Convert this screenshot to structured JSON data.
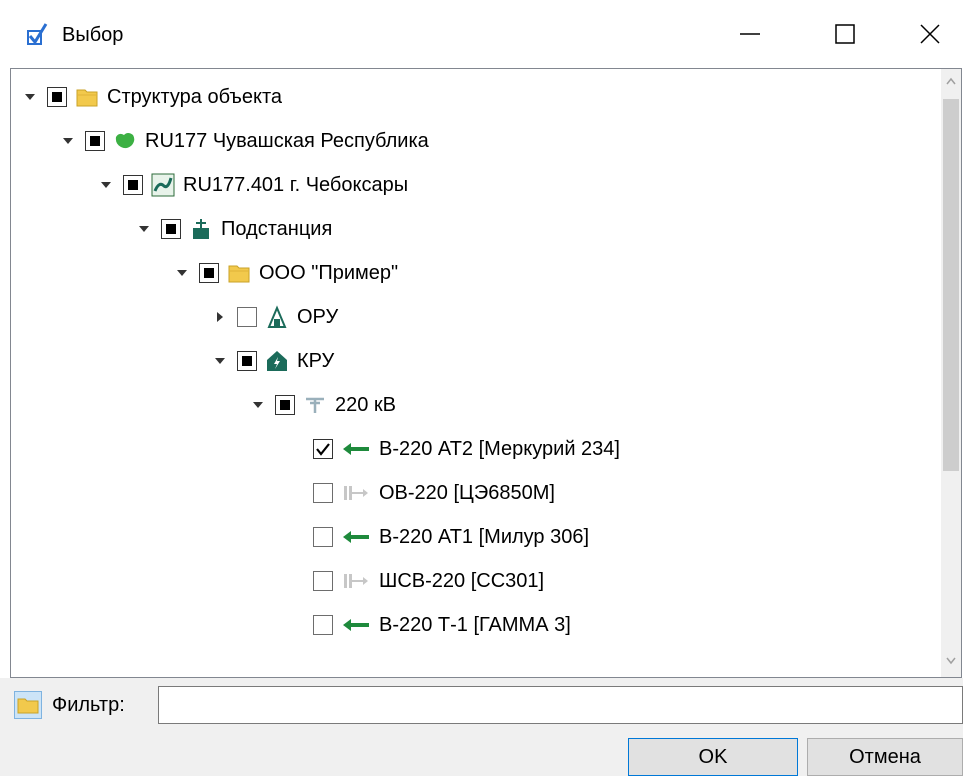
{
  "window": {
    "title": "Выбор"
  },
  "tree": {
    "items": [
      {
        "label": "Структура объекта",
        "level": 0,
        "expanded": true,
        "state": "partial",
        "icon": "folder-icon"
      },
      {
        "label": "RU177 Чувашская Республика",
        "level": 1,
        "expanded": true,
        "state": "partial",
        "icon": "region-map-icon"
      },
      {
        "label": "RU177.401 г. Чебоксары",
        "level": 2,
        "expanded": true,
        "state": "partial",
        "icon": "city-map-icon"
      },
      {
        "label": "Подстанция",
        "level": 3,
        "expanded": true,
        "state": "partial",
        "icon": "substation-icon"
      },
      {
        "label": "ООО \"Пример\"",
        "level": 4,
        "expanded": true,
        "state": "partial",
        "icon": "folder-icon"
      },
      {
        "label": "ОРУ",
        "level": 5,
        "expanded": false,
        "state": "unchecked",
        "icon": "outdoor-switchgear-icon"
      },
      {
        "label": "КРУ",
        "level": 5,
        "expanded": true,
        "state": "partial",
        "icon": "indoor-switchgear-icon"
      },
      {
        "label": "220 кВ",
        "level": 6,
        "expanded": true,
        "state": "partial",
        "icon": "voltage-level-icon"
      },
      {
        "label": "В-220 АТ2 [Меркурий 234]",
        "level": 7,
        "leaf": true,
        "state": "checked",
        "icon": "green-arrow-icon"
      },
      {
        "label": "ОВ-220 [ЦЭ6850М]",
        "level": 7,
        "leaf": true,
        "state": "unchecked",
        "icon": "gray-arrow-icon"
      },
      {
        "label": "В-220 АТ1 [Милур 306]",
        "level": 7,
        "leaf": true,
        "state": "unchecked",
        "icon": "green-arrow-icon"
      },
      {
        "label": "ШСВ-220 [СС301]",
        "level": 7,
        "leaf": true,
        "state": "unchecked",
        "icon": "gray-arrow-icon"
      },
      {
        "label": "В-220 Т-1 [ГАММА 3]",
        "level": 7,
        "leaf": true,
        "state": "unchecked",
        "icon": "green-arrow-icon"
      }
    ]
  },
  "filter": {
    "label": "Фильтр:",
    "value": ""
  },
  "buttons": {
    "ok": "OK",
    "cancel": "Отмена"
  },
  "colors": {
    "accent": "#0078d7",
    "green_arrow": "#1e8a3c",
    "folder": "#f2c94c",
    "teal": "#1b6b5a"
  }
}
